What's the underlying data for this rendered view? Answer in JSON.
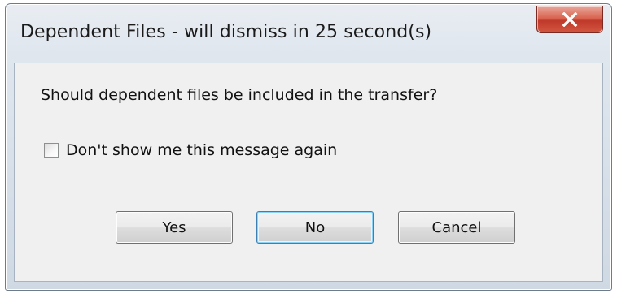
{
  "dialog": {
    "title": "Dependent Files - will dismiss in 25 second(s)",
    "message": "Should dependent files be included in the transfer?",
    "checkbox": {
      "label": "Don't show me this message again",
      "checked": false
    },
    "buttons": {
      "yes": "Yes",
      "no": "No",
      "cancel": "Cancel"
    },
    "default_button": "no",
    "close_icon": "close-x-icon",
    "colors": {
      "close_button": "#c94a37",
      "client_bg": "#f0f0f0",
      "default_border": "#3c7fb1"
    }
  }
}
